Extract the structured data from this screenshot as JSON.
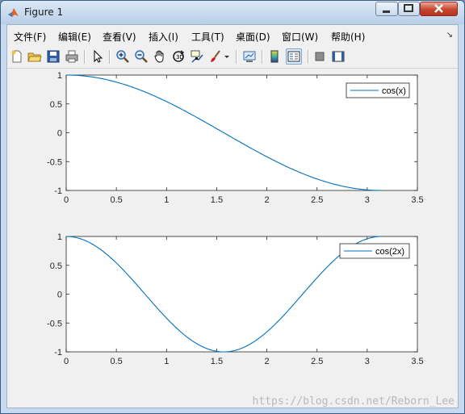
{
  "window": {
    "title": "Figure 1"
  },
  "menu": [
    {
      "label": "文件(F)"
    },
    {
      "label": "编辑(E)"
    },
    {
      "label": "查看(V)"
    },
    {
      "label": "插入(I)"
    },
    {
      "label": "工具(T)"
    },
    {
      "label": "桌面(D)"
    },
    {
      "label": "窗口(W)"
    },
    {
      "label": "帮助(H)"
    }
  ],
  "toolbar": [
    "new-figure-icon",
    "open-file-icon",
    "save-icon",
    "print-icon",
    "edit-plot-icon",
    "zoom-in-icon",
    "zoom-out-icon",
    "pan-icon",
    "rotate-3d-icon",
    "data-cursor-icon",
    "brush-icon",
    "link-plot-icon",
    "colorbar-icon",
    "legend-icon",
    "hide-plot-tools-icon",
    "show-plot-tools-icon"
  ],
  "colors": {
    "line": "#0072bd",
    "axes_bg": "#ffffff",
    "figure_bg": "#f0f0f0"
  },
  "watermark": "https://blog.csdn.net/Reborn_Lee",
  "chart_data": [
    {
      "type": "line",
      "series": [
        {
          "name": "cos(x)",
          "func": "cos(x)"
        }
      ],
      "x": [
        0,
        0.25,
        0.5,
        0.75,
        1.0,
        1.25,
        1.5,
        1.75,
        2.0,
        2.25,
        2.5,
        2.75,
        3.0,
        3.14
      ],
      "y": [
        1.0,
        0.969,
        0.878,
        0.732,
        0.54,
        0.315,
        0.071,
        -0.178,
        -0.416,
        -0.628,
        -0.801,
        -0.924,
        -0.99,
        -1.0
      ],
      "xlim": [
        0,
        3.5
      ],
      "ylim": [
        -1,
        1
      ],
      "xticks": [
        "0",
        "0.5",
        "1",
        "1.5",
        "2",
        "2.5",
        "3",
        "3.5"
      ],
      "yticks": [
        "1",
        "0.5",
        "0",
        "-0.5",
        "-1"
      ],
      "legend_position": "top-right",
      "grid": false
    },
    {
      "type": "line",
      "series": [
        {
          "name": "cos(2x)",
          "func": "cos(2x)"
        }
      ],
      "x": [
        0,
        0.25,
        0.5,
        0.75,
        1.0,
        1.25,
        1.5,
        1.75,
        2.0,
        2.25,
        2.5,
        2.75,
        3.0,
        3.14
      ],
      "y": [
        1.0,
        0.878,
        0.54,
        0.071,
        -0.416,
        -0.801,
        -0.99,
        -0.937,
        -0.654,
        -0.211,
        0.284,
        0.709,
        0.96,
        1.0
      ],
      "xlim": [
        0,
        3.5
      ],
      "ylim": [
        -1,
        1
      ],
      "xticks": [
        "0",
        "0.5",
        "1",
        "1.5",
        "2",
        "2.5",
        "3",
        "3.5"
      ],
      "yticks": [
        "1",
        "0.5",
        "0",
        "-0.5",
        "-1"
      ],
      "legend_position": "top-right",
      "grid": false
    }
  ]
}
